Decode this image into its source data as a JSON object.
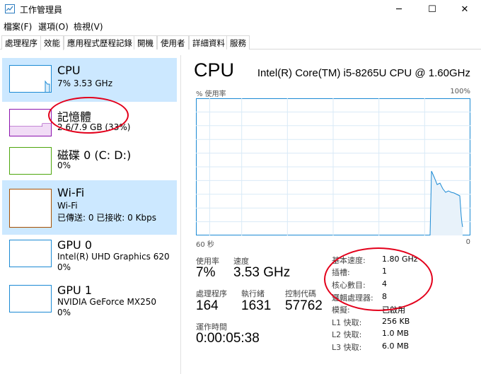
{
  "window": {
    "title": "工作管理員",
    "min_glyph": "─",
    "max_glyph": "☐",
    "close_glyph": "✕"
  },
  "menu": [
    "檔案(F)",
    "選項(O)",
    "檢視(V)"
  ],
  "tabs": [
    "處理程序",
    "效能",
    "應用程式歷程記錄",
    "開機",
    "使用者",
    "詳細資料",
    "服務"
  ],
  "active_tab": "效能",
  "sidebar": {
    "items": [
      {
        "name": "CPU",
        "line1": "7%  3.53 GHz",
        "line2": "",
        "color": "#1b8ad4",
        "selected": true
      },
      {
        "name": "記憶體",
        "line1": "2.6/7.9 GB (33%)",
        "line2": "",
        "color": "#8b12ae",
        "selected": false
      },
      {
        "name": "磁碟 0 (C: D:)",
        "line1": "0%",
        "line2": "",
        "color": "#4da60c",
        "selected": false
      },
      {
        "name": "Wi-Fi",
        "line1": "Wi-Fi",
        "line2": "已傳送: 0 已接收: 0 Kbps",
        "color": "#a74f01",
        "selected": true
      },
      {
        "name": "GPU 0",
        "line1": "Intel(R) UHD Graphics 620",
        "line2": "0%",
        "color": "#1b8ad4",
        "selected": false
      },
      {
        "name": "GPU 1",
        "line1": "NVIDIA GeForce MX250",
        "line2": "0%",
        "color": "#1b8ad4",
        "selected": false
      }
    ]
  },
  "main": {
    "title": "CPU",
    "model": "Intel(R) Core(TM) i5-8265U CPU @ 1.60GHz",
    "graph_top_left": "% 使用率",
    "graph_top_right": "100%",
    "graph_bottom_left": "60 秒",
    "graph_bottom_right": "0",
    "accent": "#1b8ad4",
    "utilization_label": "使用率",
    "utilization": "7%",
    "speed_label": "速度",
    "speed": "3.53 GHz",
    "processes_label": "處理程序",
    "processes": "164",
    "threads_label": "執行緒",
    "threads": "1631",
    "handles_label": "控制代碼",
    "handles": "57762",
    "uptime_label": "運作時間",
    "uptime": "0:00:05:38",
    "specs": [
      {
        "label": "基本速度:",
        "value": "1.80 GHz"
      },
      {
        "label": "插槽:",
        "value": "1"
      },
      {
        "label": "核心數目:",
        "value": "4"
      },
      {
        "label": "邏輯處理器:",
        "value": "8"
      },
      {
        "label": "模擬:",
        "value": "已啟用"
      },
      {
        "label": "L1 快取:",
        "value": "256 KB"
      },
      {
        "label": "L2 快取:",
        "value": "1.0 MB"
      },
      {
        "label": "L3 快取:",
        "value": "6.0 MB"
      }
    ]
  }
}
